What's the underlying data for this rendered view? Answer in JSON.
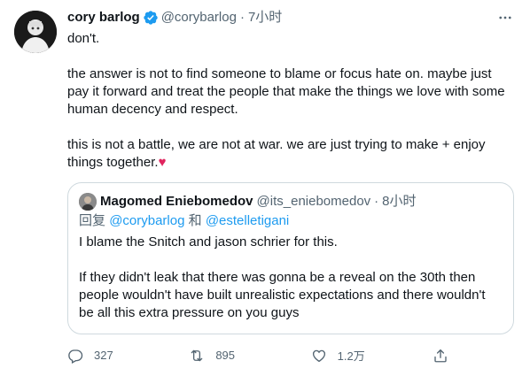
{
  "tweet": {
    "author_name": "cory barlog",
    "handle": "@corybarlog",
    "separator": "·",
    "time": "7小时",
    "paragraphs": [
      "don't.",
      "the answer is not to find someone to blame or focus hate on. maybe just pay it forward and treat the people that make the things we love with some human decency and respect.",
      "this is not a battle, we are not at war. we are just trying to make + enjoy things together."
    ],
    "heart_emoji": "♥"
  },
  "quote": {
    "author_name": "Magomed Eniebomedov",
    "handle": "@its_eniebomedov",
    "separator": "·",
    "time": "8小时",
    "reply_prefix": "回复",
    "reply_mention_1": "@corybarlog",
    "reply_and": "和",
    "reply_mention_2": "@estelletigani",
    "paragraphs": [
      "I blame the Snitch and jason schrier for this.",
      "If they didn't leak that there was gonna be a reveal on the 30th then people wouldn't have built unrealistic expectations and there wouldn't be all this extra pressure on you guys"
    ]
  },
  "actions": {
    "reply_count": "327",
    "retweet_count": "895",
    "like_count": "1.2万",
    "share_count": ""
  },
  "colors": {
    "text": "#0f1419",
    "secondary": "#536471",
    "link": "#1d9bf0",
    "verified": "#1d9bf0",
    "heart": "#e0245e",
    "border": "#cfd9de"
  },
  "icons": [
    "avatar",
    "verified-badge-icon",
    "more-icon",
    "reply-icon",
    "retweet-icon",
    "like-icon",
    "share-icon"
  ]
}
